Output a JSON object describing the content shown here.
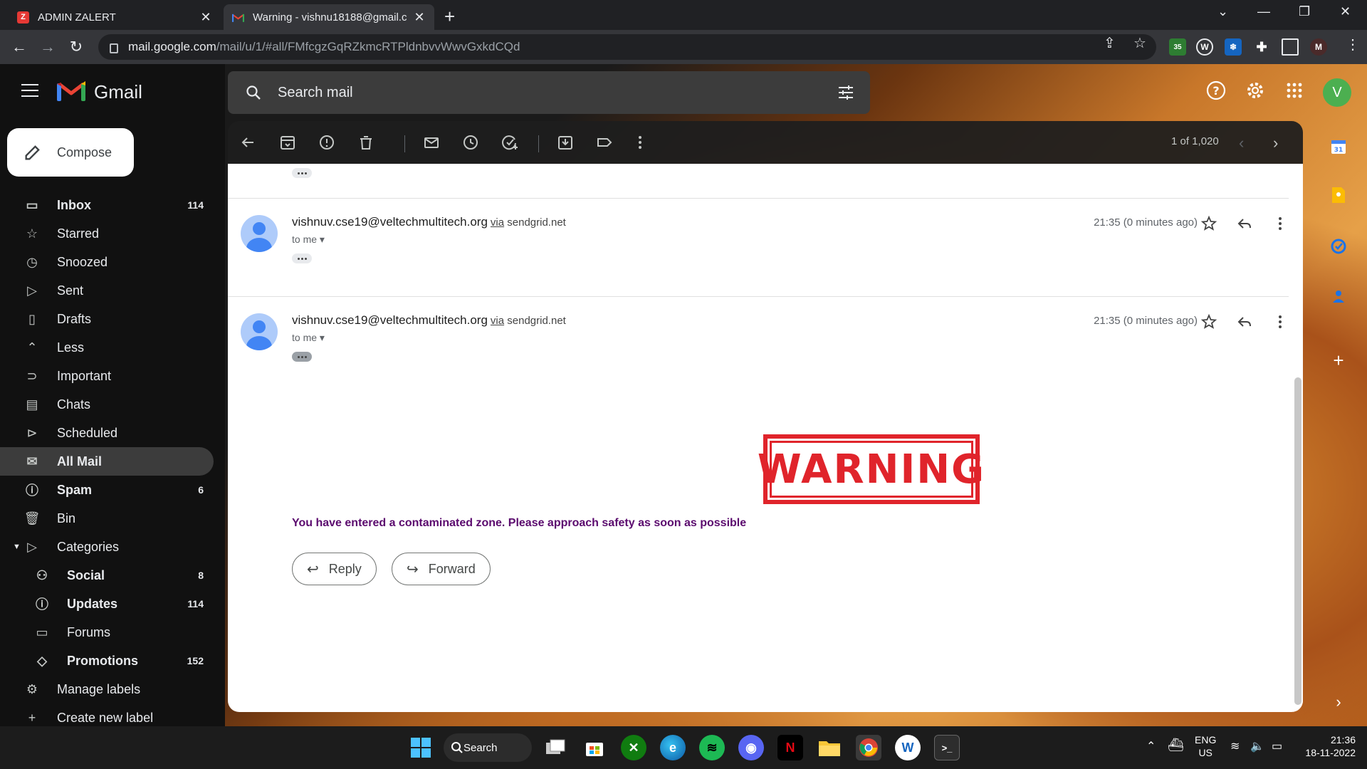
{
  "browser": {
    "tabs": [
      {
        "title": "ADMIN ZALERT",
        "favicon": "zalert-favicon"
      },
      {
        "title": "Warning - vishnu18188@gmail.c",
        "favicon": "gmail-favicon"
      }
    ],
    "url_host": "mail.google.com",
    "url_path": "/mail/u/1/#all/FMfcgzGqRZkmcRTPldnbvvWwvGxkdCQd",
    "ext_badge": "35"
  },
  "gmail": {
    "brand": "Gmail",
    "search_placeholder": "Search mail",
    "compose_label": "Compose",
    "avatar_letter": "V",
    "nav": [
      {
        "label": "Inbox",
        "count": "114",
        "bold": true,
        "icon": "inbox-icon"
      },
      {
        "label": "Starred",
        "count": "",
        "bold": false,
        "icon": "star-icon"
      },
      {
        "label": "Snoozed",
        "count": "",
        "bold": false,
        "icon": "clock-icon"
      },
      {
        "label": "Sent",
        "count": "",
        "bold": false,
        "icon": "send-icon"
      },
      {
        "label": "Drafts",
        "count": "",
        "bold": false,
        "icon": "draft-icon"
      },
      {
        "label": "Less",
        "count": "",
        "bold": false,
        "icon": "chevron-up-icon"
      },
      {
        "label": "Important",
        "count": "",
        "bold": false,
        "icon": "label-important-icon"
      },
      {
        "label": "Chats",
        "count": "",
        "bold": false,
        "icon": "chat-icon"
      },
      {
        "label": "Scheduled",
        "count": "",
        "bold": false,
        "icon": "schedule-send-icon"
      },
      {
        "label": "All Mail",
        "count": "",
        "bold": true,
        "icon": "all-mail-icon",
        "active": true
      },
      {
        "label": "Spam",
        "count": "6",
        "bold": true,
        "icon": "report-icon"
      },
      {
        "label": "Bin",
        "count": "",
        "bold": false,
        "icon": "trash-icon"
      },
      {
        "label": "Categories",
        "count": "",
        "bold": false,
        "icon": "label-icon"
      },
      {
        "label": "Social",
        "count": "8",
        "bold": true,
        "icon": "people-icon",
        "sub": true
      },
      {
        "label": "Updates",
        "count": "114",
        "bold": true,
        "icon": "info-icon",
        "sub": true
      },
      {
        "label": "Forums",
        "count": "",
        "bold": false,
        "icon": "forum-icon",
        "sub": true
      },
      {
        "label": "Promotions",
        "count": "152",
        "bold": true,
        "icon": "tag-icon",
        "sub": true
      },
      {
        "label": "Manage labels",
        "count": "",
        "bold": false,
        "icon": "settings-icon"
      },
      {
        "label": "Create new label",
        "count": "",
        "bold": false,
        "icon": "plus-icon"
      }
    ],
    "pager": "1 of 1,020",
    "messages": [
      {
        "from": "vishnuv.cse19@veltechmultitech.org",
        "via_label": "via",
        "via_domain": "sendgrid.net",
        "to": "to me",
        "time": "21:35 (0 minutes ago)"
      },
      {
        "from": "vishnuv.cse19@veltechmultitech.org",
        "via_label": "via",
        "via_domain": "sendgrid.net",
        "to": "to me",
        "time": "21:35 (0 minutes ago)"
      }
    ],
    "warning_image_text": "WARNING",
    "body_text": "You have entered a contaminated zone. Please approach safety as soon as possible",
    "reply_label": "Reply",
    "forward_label": "Forward"
  },
  "taskbar": {
    "search_label": "Search",
    "lang": "ENG",
    "region": "US",
    "time": "21:36",
    "date": "18-11-2022"
  },
  "colors": {
    "warning_red": "#e0242b",
    "body_text_purple": "#5b0a6e",
    "active_nav": "#3c3c3c"
  }
}
